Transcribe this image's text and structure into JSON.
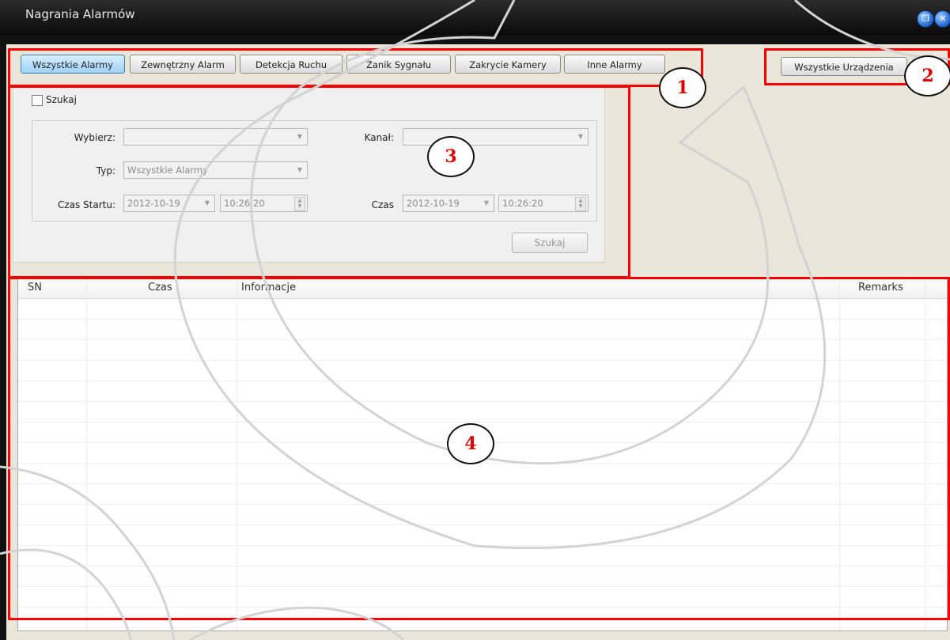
{
  "window": {
    "title": "Nagrania Alarmów",
    "restore_icon": "restore-icon",
    "close_icon": "close-icon"
  },
  "tabs": [
    {
      "label": "Wszystkie Alarmy",
      "active": true
    },
    {
      "label": "Zewnętrzny Alarm",
      "active": false
    },
    {
      "label": "Detekcja Ruchu",
      "active": false
    },
    {
      "label": "Zanik Sygnału",
      "active": false
    },
    {
      "label": "Zakrycie Kamery",
      "active": false
    },
    {
      "label": "Inne Alarmy",
      "active": false
    }
  ],
  "device_button": {
    "label": "Wszystkie Urządzenia"
  },
  "search": {
    "checkbox_label": "Szukaj",
    "checked": false,
    "select_label": "Wybierz:",
    "select_value": "",
    "channel_label": "Kanał:",
    "channel_value": "",
    "type_label": "Typ:",
    "type_value": "Wszystkie Alarmy",
    "start_label": "Czas Startu:",
    "start_date": "2012-10-19",
    "start_time": "10:26:20",
    "end_label": "Czas",
    "end_date": "2012-10-19",
    "end_time": "10:26:20",
    "button_label": "Szukaj"
  },
  "table": {
    "columns": [
      "SN",
      "Czas",
      "Informacje",
      "Remarks"
    ],
    "rows": []
  },
  "callouts": [
    "1",
    "2",
    "3",
    "4"
  ],
  "colors": {
    "annotation_red": "#ff0000",
    "callout_text": "#e00000",
    "active_tab": "#9fd1f6"
  }
}
